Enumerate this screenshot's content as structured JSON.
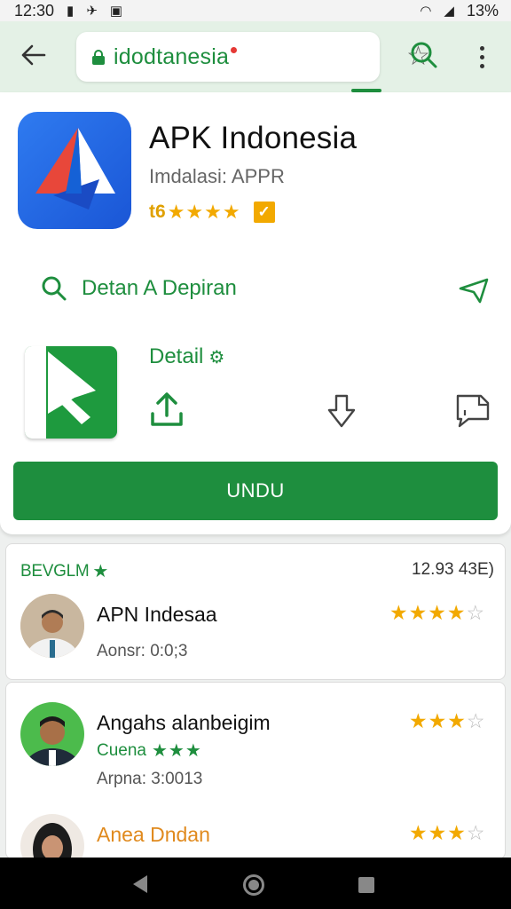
{
  "status_bar": {
    "time": "12:30",
    "battery": "13%",
    "left_icons": [
      "notification-icon",
      "alarm-icon",
      "image-icon"
    ],
    "right_icons": [
      "wifi-icon",
      "signal-icon",
      "battery-icon"
    ]
  },
  "browser": {
    "url": "idodtanesia",
    "icons": [
      "back-arrow-icon",
      "lock-icon",
      "star-icon",
      "search-icon",
      "more-vert-icon"
    ]
  },
  "app": {
    "title": "APK Indonesia",
    "developer": "Imdalasi: APPR",
    "rating_text": "t6",
    "rating_stars": "★★★★",
    "search_link": "Detan A Depiran",
    "detail_label": "Detail",
    "download_button": "UNDU"
  },
  "reviews": {
    "header": "BEVGLM",
    "count": "12.93 43E)",
    "items": [
      {
        "name": "APN Indesaa",
        "date": "Aonsr: 0:0;3",
        "stars_filled": "★★★★",
        "stars_empty": "☆"
      },
      {
        "name": "Angahs alanbeigim",
        "sub": "Cuena",
        "sub_stars": "★★★",
        "date": "Arpna: 3:0013",
        "stars_filled": "★★★",
        "stars_empty": "☆"
      },
      {
        "name": "Anea Dndan",
        "stars_filled": "★★★",
        "stars_empty": "☆"
      }
    ]
  },
  "colors": {
    "brand_green": "#1e8e3e",
    "star_gold": "#f2a900",
    "app_icon_blue": "#2f7bf0"
  }
}
